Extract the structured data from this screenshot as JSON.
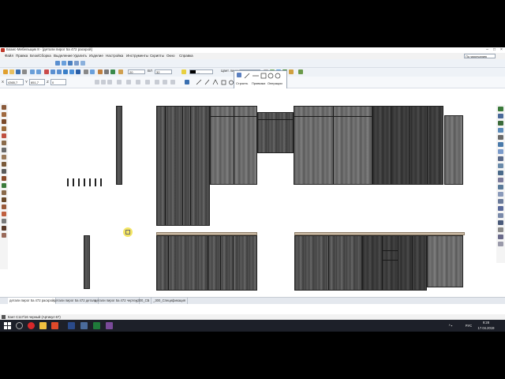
{
  "window": {
    "title": "Базис-Мебельщик 8 - [детали пирог 5а 472 раскрой]",
    "minimize": "–",
    "maximize": "□",
    "close": "×"
  },
  "menu": [
    "Файл",
    "Правка",
    "Блок/Сборка",
    "Выделение",
    "Удалить",
    "Изделие",
    "Настройка",
    "Инструменты",
    "Скрипты",
    "Окно",
    "Справка"
  ],
  "toolbar": {
    "view_mode": "По умолчанию",
    "scale_value": "20",
    "height_label": "ВЛ",
    "height_value": "32",
    "thickness_label": "Цвет линии",
    "color_value": "...",
    "coord_x_label": "X",
    "coord_x": "4365,7",
    "coord_y_label": "Y",
    "coord_y": "851,7",
    "coord_z_label": "Z",
    "coord_z": "0",
    "tabs3d": [
      "Строить",
      "Привязки",
      "Операции"
    ]
  },
  "doc_tabs": [
    "детали пирог 5а 472 раскрой",
    "детали пирог 5а 472 деталь",
    "детали пирог 5а 472 чертеж",
    "_300_СБ",
    "_300_Спецификация"
  ],
  "status": {
    "text": "Кант С117/16 черный (Артикул 67)"
  },
  "taskbar": {
    "lang": "РУС",
    "time": "9:28",
    "date": "17.04.2019"
  },
  "colors": {
    "accent": "#1f6fb5",
    "taskbar": "#1d2029",
    "wood_dark": "#3a3a3a",
    "counter": "#c9b9a3"
  }
}
